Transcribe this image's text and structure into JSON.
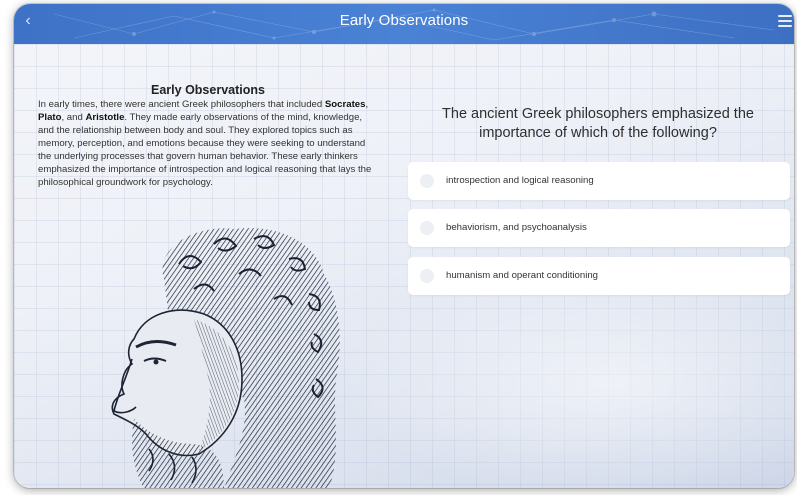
{
  "header": {
    "title": "Early Observations",
    "back_icon": "chevron-left-icon",
    "menu_icon": "hamburger-menu-icon",
    "color": "#4a82d6"
  },
  "article": {
    "heading": "Early Observations",
    "text_1": "In early times, there were ancient Greek philosophers that included ",
    "name_1": "Socrates",
    "text_2": ", ",
    "name_2": "Plato",
    "text_3": ", and ",
    "name_3": "Aristotle",
    "text_4": ". They made early observations of the mind, knowledge, and the relationship between body and soul. They explored topics such as memory, perception, and emotions because they were seeking to understand the underlying processes that govern human behavior. These early thinkers emphasized the importance of introspection and logical reasoning that lays the philosophical groundwork for psychology."
  },
  "quiz": {
    "question": "The ancient Greek philosophers emphasized the importance of which of the following?",
    "options": [
      {
        "label": "introspection and logical reasoning"
      },
      {
        "label": "behaviorism, and psychoanalysis"
      },
      {
        "label": "humanism and operant conditioning"
      }
    ]
  }
}
